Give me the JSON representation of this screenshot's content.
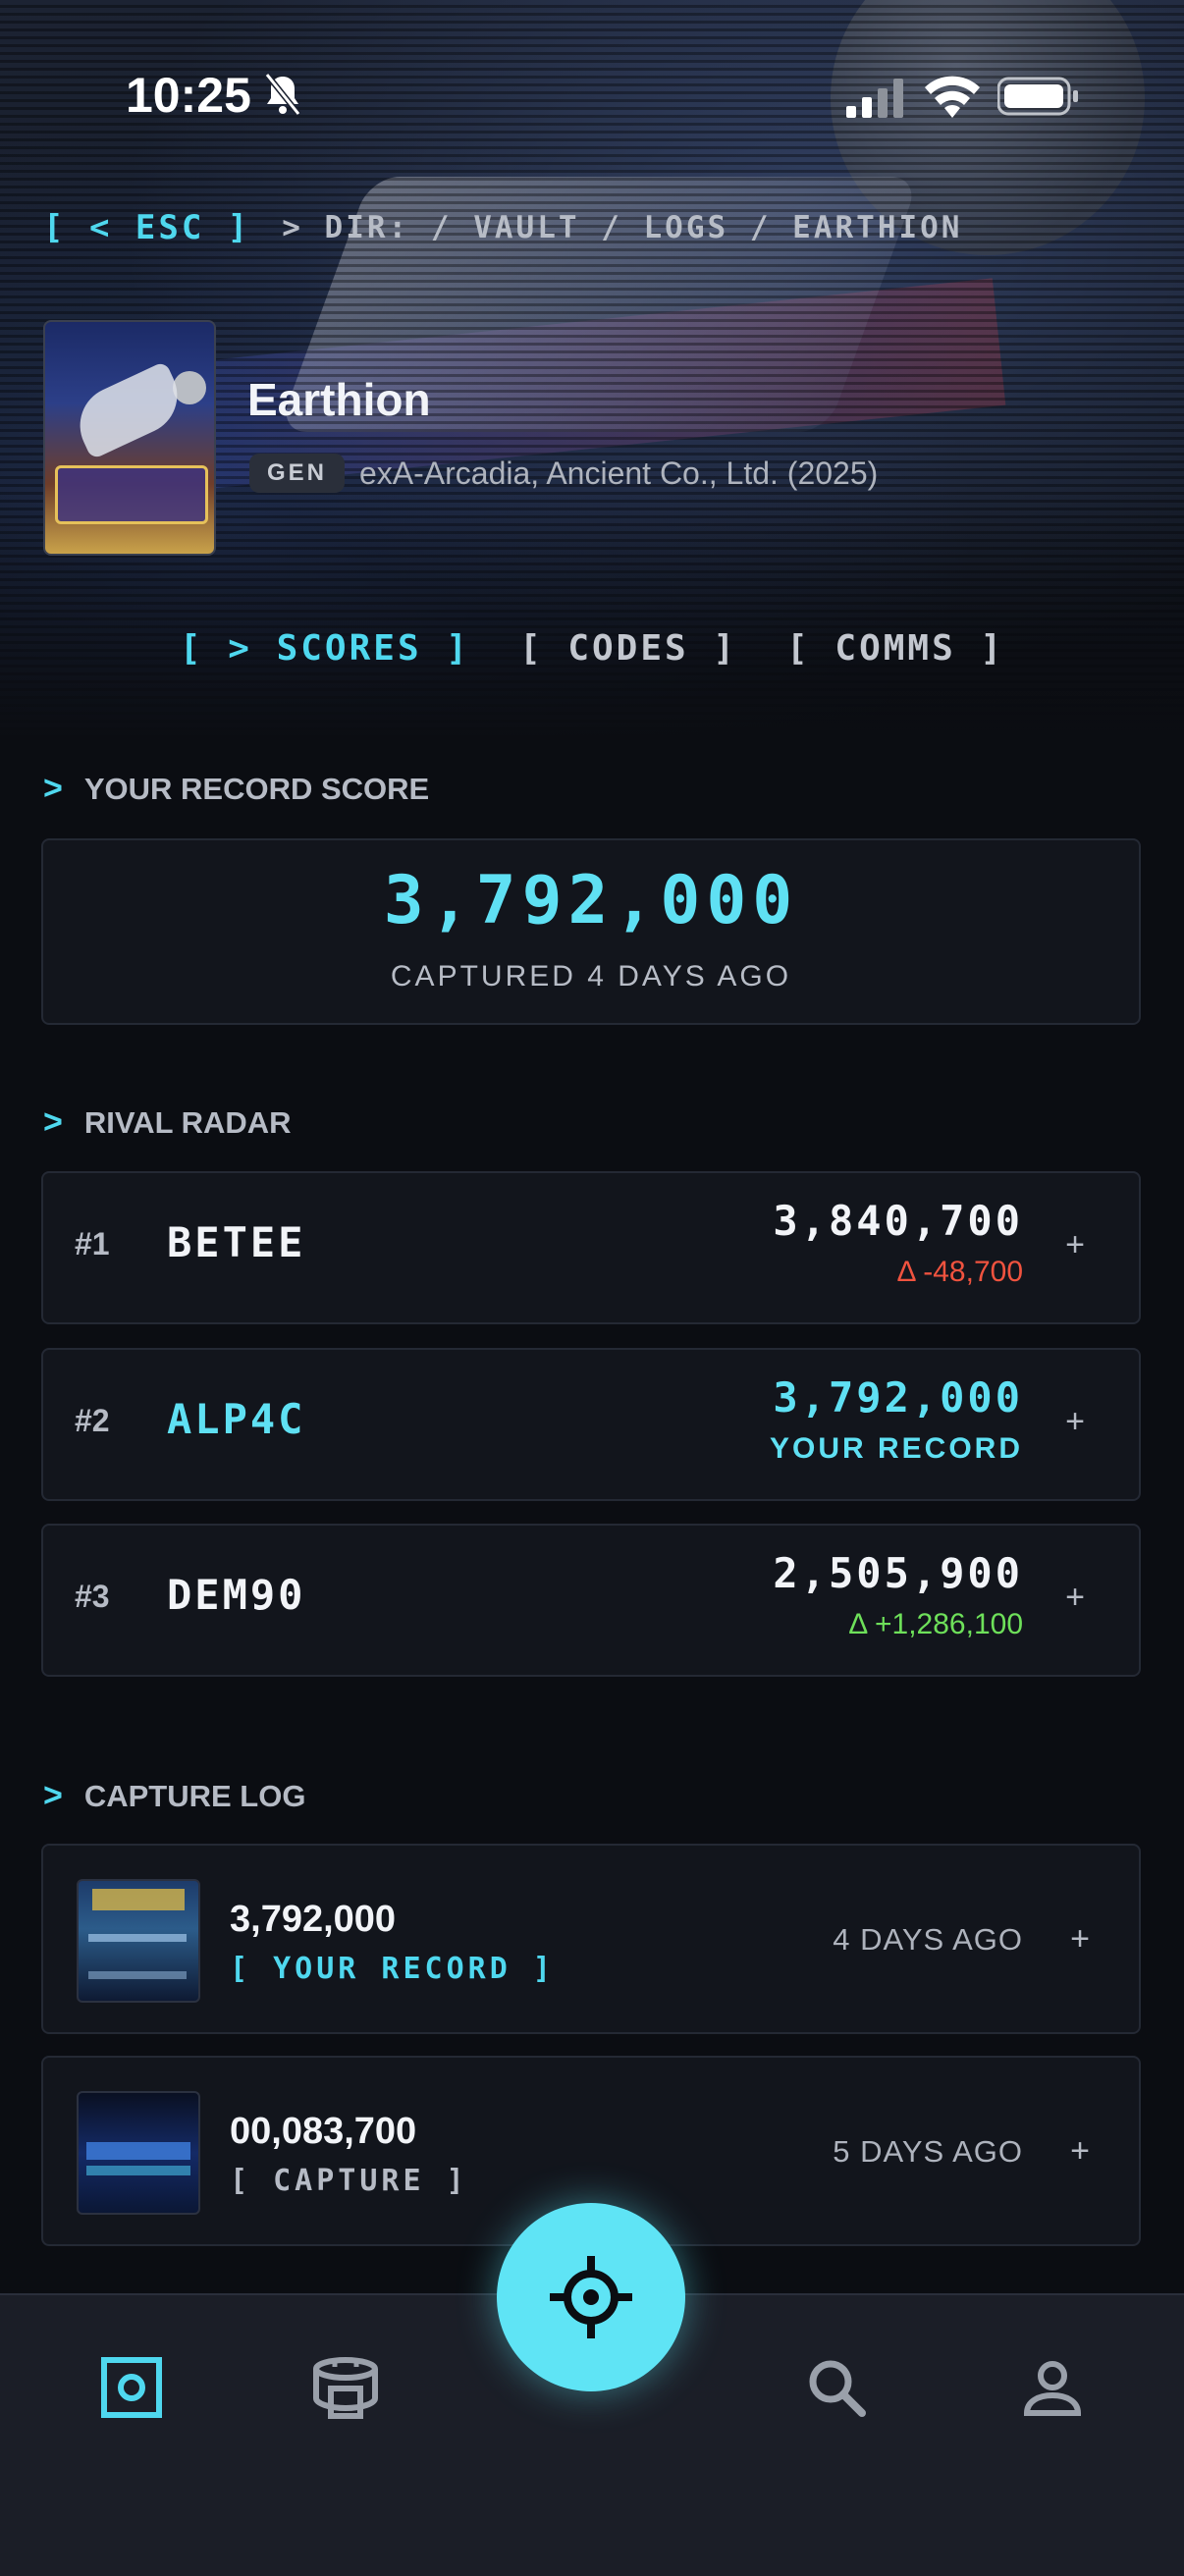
{
  "status_bar": {
    "time": "10:25"
  },
  "breadcrumb": {
    "esc_label": "[ < ESC ]",
    "path": "> DIR: / VAULT / LOGS / EARTHION"
  },
  "game": {
    "title": "Earthion",
    "platform_badge": "GEN",
    "publisher": "exA-Arcadia, Ancient Co., Ltd. (2025)"
  },
  "tabs": [
    {
      "label": "[ > SCORES ]",
      "active": true
    },
    {
      "label": "[ CODES ]",
      "active": false
    },
    {
      "label": "[ COMMS ]",
      "active": false
    }
  ],
  "record": {
    "section_label": "YOUR RECORD SCORE",
    "score": "3,792,000",
    "captured": "CAPTURED 4 DAYS AGO"
  },
  "rival_radar": {
    "section_label": "RIVAL RADAR",
    "entries": [
      {
        "rank": "#1",
        "name": "BETEE",
        "score": "3,840,700",
        "sub": "Δ -48,700",
        "sub_color": "#f0533f",
        "is_you": false
      },
      {
        "rank": "#2",
        "name": "ALP4C",
        "score": "3,792,000",
        "sub": "YOUR RECORD",
        "sub_color": "#5fe0f3",
        "is_you": true
      },
      {
        "rank": "#3",
        "name": "DEM90",
        "score": "2,505,900",
        "sub": "Δ +1,286,100",
        "sub_color": "#6ee05a",
        "is_you": false
      }
    ]
  },
  "capture_log": {
    "section_label": "CAPTURE LOG",
    "entries": [
      {
        "score": "3,792,000",
        "tag": "[ YOUR RECORD ]",
        "tag_color": "#4fd8ef",
        "time": "4 DAYS AGO"
      },
      {
        "score": "00,083,700",
        "tag": "[ CAPTURE ]",
        "tag_color": "#b6bbc5",
        "time": "5 DAYS AGO"
      }
    ]
  },
  "colors": {
    "accent": "#5fe4f5",
    "background": "#0b0d12",
    "card": "#12151c"
  },
  "nav": {
    "items": [
      "vault-icon",
      "arcade-cabinet-icon",
      "crosshair-icon",
      "search-icon",
      "profile-icon"
    ]
  }
}
